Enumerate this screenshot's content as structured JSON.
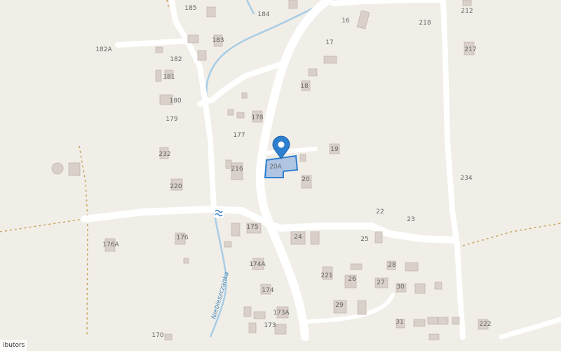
{
  "map": {
    "river_name": "Niebieszczanka",
    "attribution": "ibutors",
    "accent_color": "#2f7fd0",
    "building_fill": "#d9d0c9",
    "building_stroke": "#c4b8ae",
    "road_color": "#ffffff",
    "water_color": "#a8cde6",
    "boundary_color": "#c9a45a",
    "marker_icon": "map-pin-icon",
    "crossing_icon": "waves-icon",
    "labels": [
      "185",
      "184",
      "16",
      "218",
      "212",
      "182A",
      "183",
      "17",
      "217",
      "182",
      "181",
      "18",
      "180",
      "179",
      "178",
      "177",
      "232",
      "216",
      "19",
      "20A",
      "234",
      "220",
      "20",
      "22",
      "23",
      "175",
      "24",
      "25",
      "176A",
      "176",
      "174A",
      "28",
      "221",
      "26",
      "27",
      "30",
      "174",
      "29",
      "173A",
      "31",
      "222",
      "170",
      "173"
    ]
  }
}
